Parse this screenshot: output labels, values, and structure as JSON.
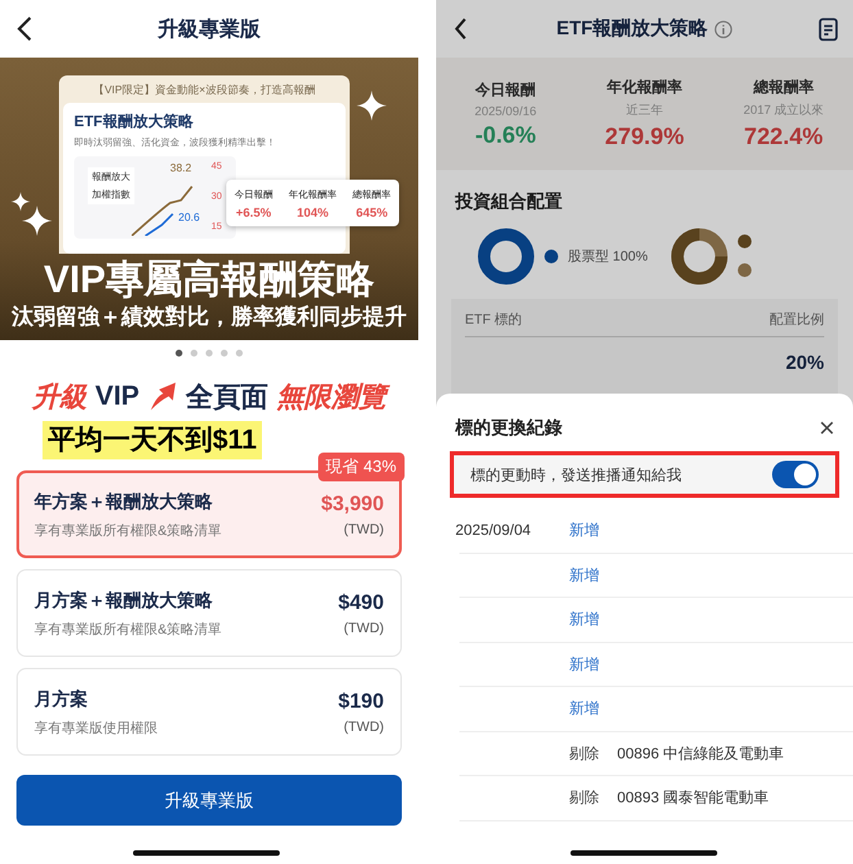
{
  "left": {
    "header": {
      "title": "升級專業版"
    },
    "banner": {
      "tagline": "【VIP限定】資金動能×波段節奏，打造高報酬",
      "card_title": "ETF報酬放大策略",
      "card_text": "即時汰弱留強、活化資金，波段獲利精準出擊！",
      "legend": [
        "報酬放大",
        "加權指數"
      ],
      "chart_labels": [
        "38.2",
        "20.6"
      ],
      "axis_labels": [
        "45",
        "30",
        "15"
      ],
      "stats": [
        {
          "label": "今日報酬",
          "value": "+6.5%"
        },
        {
          "label": "年化報酬率",
          "value": "104%"
        },
        {
          "label": "總報酬率",
          "value": "645%"
        }
      ],
      "headline": "VIP專屬高報酬策略",
      "subline": "汰弱留強＋績效對比，勝率獲利同步提升"
    },
    "carousel_dots": [
      {
        "selected": true
      },
      {
        "selected": false
      },
      {
        "selected": false
      },
      {
        "selected": false
      },
      {
        "selected": false
      }
    ],
    "promo": [
      {
        "kind": "accent",
        "text": "升級"
      },
      {
        "kind": "plain",
        "text": "VIP"
      },
      {
        "kind": "arrow"
      },
      {
        "kind": "plain",
        "text": "全頁面"
      },
      {
        "kind": "accent",
        "text": "無限瀏覽"
      }
    ],
    "price_note": "平均一天不到$11",
    "plans": [
      {
        "name": "年方案＋報酬放大策略",
        "description": "享有專業版所有權限&策略清單",
        "price": "$3,990",
        "currency": "(TWD)",
        "badge": "現省 43%",
        "selected": true
      },
      {
        "name": "月方案＋報酬放大策略",
        "description": "享有專業版所有權限&策略清單",
        "price": "$490",
        "currency": "(TWD)",
        "selected": false
      },
      {
        "name": "月方案",
        "description": "享有專業版使用權限",
        "price": "$190",
        "currency": "(TWD)",
        "selected": false
      }
    ],
    "button": "升級專業版"
  },
  "right": {
    "header": {
      "title": "ETF報酬放大策略"
    },
    "stats": [
      {
        "label": "今日報酬",
        "sub": "2025/09/16",
        "value": "-0.6%",
        "color": "#258057"
      },
      {
        "label": "年化報酬率",
        "sub": "近三年",
        "value": "279.9%",
        "color": "#ad3838"
      },
      {
        "label": "總報酬率",
        "sub": "2017 成立以來",
        "value": "722.4%",
        "color": "#ad3838"
      }
    ],
    "portfolio": {
      "title": "投資組合配置",
      "legend": "股票型 100%"
    },
    "table": {
      "columns": [
        "ETF 標的",
        "配置比例"
      ],
      "value": "20%"
    },
    "sheet": {
      "title": "標的更換紀錄",
      "notify": {
        "label": "標的更動時，發送推播通知給我",
        "on": true,
        "highlighted": true
      },
      "records": [
        {
          "date": "2025/09/04",
          "action": "新增",
          "kind": "add"
        },
        {
          "action": "新增",
          "kind": "add"
        },
        {
          "action": "新增",
          "kind": "add"
        },
        {
          "action": "新增",
          "kind": "add"
        },
        {
          "action": "新增",
          "kind": "add"
        },
        {
          "action": "剔除",
          "target": "00896 中信綠能及電動車",
          "kind": "remove"
        },
        {
          "action": "剔除",
          "target": "00893 國泰智能電動車",
          "kind": "remove"
        }
      ]
    }
  }
}
